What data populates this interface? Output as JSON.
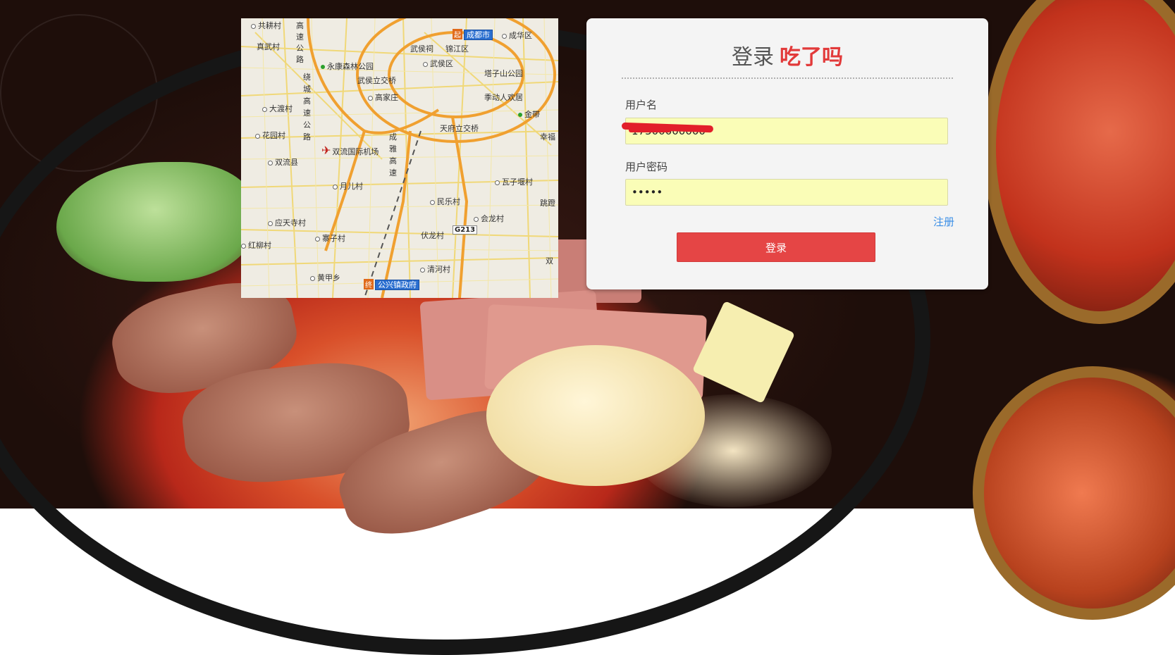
{
  "login": {
    "title": "登录",
    "brand": "吃了吗",
    "username_label": "用户名",
    "username_value": "17500000000",
    "password_label": "用户密码",
    "password_value": "•••••",
    "register_label": "注册",
    "submit_label": "登录"
  },
  "map": {
    "places": [
      {
        "name": "共耕村",
        "kind": "village"
      },
      {
        "name": "高速公路",
        "kind": "road"
      },
      {
        "name": "成都市",
        "kind": "city"
      },
      {
        "name": "成华区",
        "kind": "village"
      },
      {
        "name": "真武村",
        "kind": "village"
      },
      {
        "name": "武侯祠",
        "kind": "park"
      },
      {
        "name": "锦江区",
        "kind": "village"
      },
      {
        "name": "永康森林公园",
        "kind": "park"
      },
      {
        "name": "武侯区",
        "kind": "village"
      },
      {
        "name": "武侯立交桥",
        "kind": "park"
      },
      {
        "name": "塔子山公园",
        "kind": "park"
      },
      {
        "name": "绕城高速公路",
        "kind": "road"
      },
      {
        "name": "高家庄",
        "kind": "village"
      },
      {
        "name": "季动人欢居",
        "kind": "park"
      },
      {
        "name": "大渡村",
        "kind": "village"
      },
      {
        "name": "金带",
        "kind": "park"
      },
      {
        "name": "天府立交桥",
        "kind": "village"
      },
      {
        "name": "花园村",
        "kind": "village"
      },
      {
        "name": "双流国际机场",
        "kind": "airport"
      },
      {
        "name": "双流县",
        "kind": "village"
      },
      {
        "name": "成雅高速",
        "kind": "road"
      },
      {
        "name": "月儿村",
        "kind": "village"
      },
      {
        "name": "瓦子堰村",
        "kind": "village"
      },
      {
        "name": "民乐村",
        "kind": "village"
      },
      {
        "name": "应天寺村",
        "kind": "village"
      },
      {
        "name": "会龙村",
        "kind": "village"
      },
      {
        "name": "G213",
        "kind": "highway"
      },
      {
        "name": "寨子村",
        "kind": "village"
      },
      {
        "name": "伏龙村",
        "kind": "village"
      },
      {
        "name": "红柳村",
        "kind": "village"
      },
      {
        "name": "清河村",
        "kind": "village"
      },
      {
        "name": "黄甲乡",
        "kind": "village"
      },
      {
        "name": "公兴镇政府",
        "kind": "gov"
      },
      {
        "name": "幸福",
        "kind": "village"
      },
      {
        "name": "跳蹬",
        "kind": "village"
      },
      {
        "name": "双",
        "kind": "village"
      }
    ]
  },
  "colors": {
    "brand": "#e23a3a",
    "button": "#e54545",
    "link": "#3a8ee6",
    "input_bg": "#fafdb7"
  }
}
